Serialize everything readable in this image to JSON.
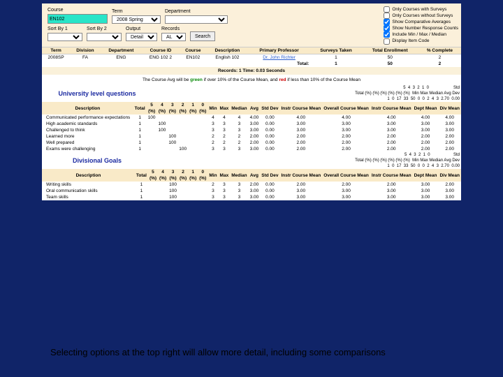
{
  "filters": {
    "course_label": "Course",
    "course_value": "EN102",
    "term_label": "Term",
    "term_value": "2008 Spring",
    "dept_label": "Department",
    "dept_value": "",
    "sort1_label": "Sort By 1",
    "sort1_value": "",
    "sort2_label": "Sort By 2",
    "sort2_value": "",
    "output_label": "Output",
    "output_value": "Detail",
    "records_label": "Records",
    "records_value": "ALL",
    "search_label": "Search"
  },
  "options": {
    "o1": "Only Courses with Surveys",
    "o2": "Only Courses without Surveys",
    "o3": "Show Comparative Averages",
    "o4": "Show Number Response Counts",
    "o5": "Include Min / Max / Median",
    "o6": "Display Item Code",
    "c1": false,
    "c2": false,
    "c3": true,
    "c4": true,
    "c5": true,
    "c6": false
  },
  "results": {
    "headers": [
      "Term",
      "Division",
      "Department",
      "Course ID",
      "Course",
      "Description",
      "Primary Professor",
      "Surveys Taken",
      "Total Enrollment",
      "% Complete"
    ],
    "row": {
      "term": "2008SP",
      "division": "FA",
      "department": "ENG",
      "course_id": "ENG 102 2",
      "course": "EN102",
      "desc": "English 102",
      "prof": "Dr. John Richter",
      "surveys": "1",
      "enroll": "50",
      "pct": "2"
    },
    "total_label": "Total:",
    "total_surveys": "1",
    "total_enroll": "50",
    "total_pct": "2",
    "meta": "Records: 1   Time: 0.03 Seconds"
  },
  "note": {
    "pre": "The Course Avg will be ",
    "g": "green",
    "mid": " if over 10% of the Course Mean, and ",
    "r": "red",
    "post": " if less than 10% of the Course Mean"
  },
  "dist_header": {
    "nums": [
      "5",
      "4",
      "3",
      "2",
      "1",
      "0"
    ],
    "pcts": [
      "(%)",
      "(%)",
      "(%)",
      "(%)",
      "(%)",
      "(%)"
    ],
    "cols": [
      "Total"
    ],
    "right": [
      "Min",
      "Max",
      "Median",
      "Avg",
      "Std Dev"
    ],
    "vals": [
      "1",
      "0",
      "17",
      "33",
      "50",
      "0",
      "0",
      "2",
      "4",
      "3",
      "2.70",
      "0.00"
    ]
  },
  "sections": {
    "univ_title": "University level questions",
    "div_title": "Divisional Goals"
  },
  "pivot_headers": {
    "desc": "Description",
    "nums": [
      "5",
      "4",
      "3",
      "2",
      "1",
      "0"
    ],
    "pcts": [
      "(%)",
      "(%)",
      "(%)",
      "(%)",
      "(%)",
      "(%)"
    ],
    "total": "Total",
    "extra": [
      "Min",
      "Max",
      "Median",
      "Avg",
      "Std Dev",
      "Instr Course Mean",
      "Overall Course Mean",
      "Instr Course Mean",
      "Dept Mean",
      "Div Mean"
    ]
  },
  "univ_rows": [
    {
      "d": "Communicated performance expectations",
      "t": "1",
      "p": [
        "100",
        "",
        "",
        "",
        "",
        ""
      ],
      "mn": "4",
      "mx": "4",
      "md": "4",
      "av": "4.00",
      "sd": "0.00",
      "a": "4.00",
      "b": "4.00",
      "c": "4.00",
      "dp": "4.00",
      "dv": "4.00"
    },
    {
      "d": "High academic standards",
      "t": "1",
      "p": [
        "",
        "100",
        "",
        "",
        "",
        ""
      ],
      "mn": "3",
      "mx": "3",
      "md": "3",
      "av": "3.00",
      "sd": "0.00",
      "a": "3.00",
      "b": "3.00",
      "c": "3.00",
      "dp": "3.00",
      "dv": "3.00"
    },
    {
      "d": "Challenged to think",
      "t": "1",
      "p": [
        "",
        "100",
        "",
        "",
        "",
        ""
      ],
      "mn": "3",
      "mx": "3",
      "md": "3",
      "av": "3.00",
      "sd": "0.00",
      "a": "3.00",
      "b": "3.00",
      "c": "3.00",
      "dp": "3.00",
      "dv": "3.00"
    },
    {
      "d": "Learned more",
      "t": "1",
      "p": [
        "",
        "",
        "100",
        "",
        "",
        ""
      ],
      "mn": "2",
      "mx": "2",
      "md": "2",
      "av": "2.00",
      "sd": "0.00",
      "a": "2.00",
      "b": "2.00",
      "c": "2.00",
      "dp": "2.00",
      "dv": "2.00"
    },
    {
      "d": "Well prepared",
      "t": "1",
      "p": [
        "",
        "",
        "100",
        "",
        "",
        ""
      ],
      "mn": "2",
      "mx": "2",
      "md": "2",
      "av": "2.00",
      "sd": "0.00",
      "a": "2.00",
      "b": "2.00",
      "c": "2.00",
      "dp": "2.00",
      "dv": "2.00"
    },
    {
      "d": "Exams were challenging",
      "t": "1",
      "p": [
        "",
        "",
        "",
        "100",
        "",
        ""
      ],
      "mn": "3",
      "mx": "3",
      "md": "3",
      "av": "3.00",
      "sd": "0.00",
      "a": "2.00",
      "b": "2.00",
      "c": "2.00",
      "dp": "2.00",
      "dv": "2.00"
    }
  ],
  "div_rows": [
    {
      "d": "Writing skills",
      "t": "1",
      "p": [
        "",
        "",
        "100",
        "",
        "",
        ""
      ],
      "mn": "2",
      "mx": "3",
      "md": "3",
      "av": "2.00",
      "sd": "0.00",
      "a": "2.00",
      "b": "2.00",
      "c": "2.00",
      "dp": "3.00",
      "dv": "2.00"
    },
    {
      "d": "Oral communication skills",
      "t": "1",
      "p": [
        "",
        "",
        "100",
        "",
        "",
        ""
      ],
      "mn": "3",
      "mx": "3",
      "md": "3",
      "av": "3.00",
      "sd": "0.00",
      "a": "3.00",
      "b": "3.00",
      "c": "3.00",
      "dp": "3.00",
      "dv": "3.00"
    },
    {
      "d": "Team skills",
      "t": "1",
      "p": [
        "",
        "",
        "100",
        "",
        "",
        ""
      ],
      "mn": "3",
      "mx": "3",
      "md": "3",
      "av": "3.00",
      "sd": "0.00",
      "a": "3.00",
      "b": "3.00",
      "c": "3.00",
      "dp": "3.00",
      "dv": "3.00"
    }
  ],
  "dist2_vals": [
    "1",
    "0",
    "17",
    "33",
    "50",
    "0",
    "0",
    "2",
    "4",
    "3",
    "2.70",
    "0.00"
  ],
  "caption": "Selecting options at the top right will allow more detail, including some comparisons"
}
